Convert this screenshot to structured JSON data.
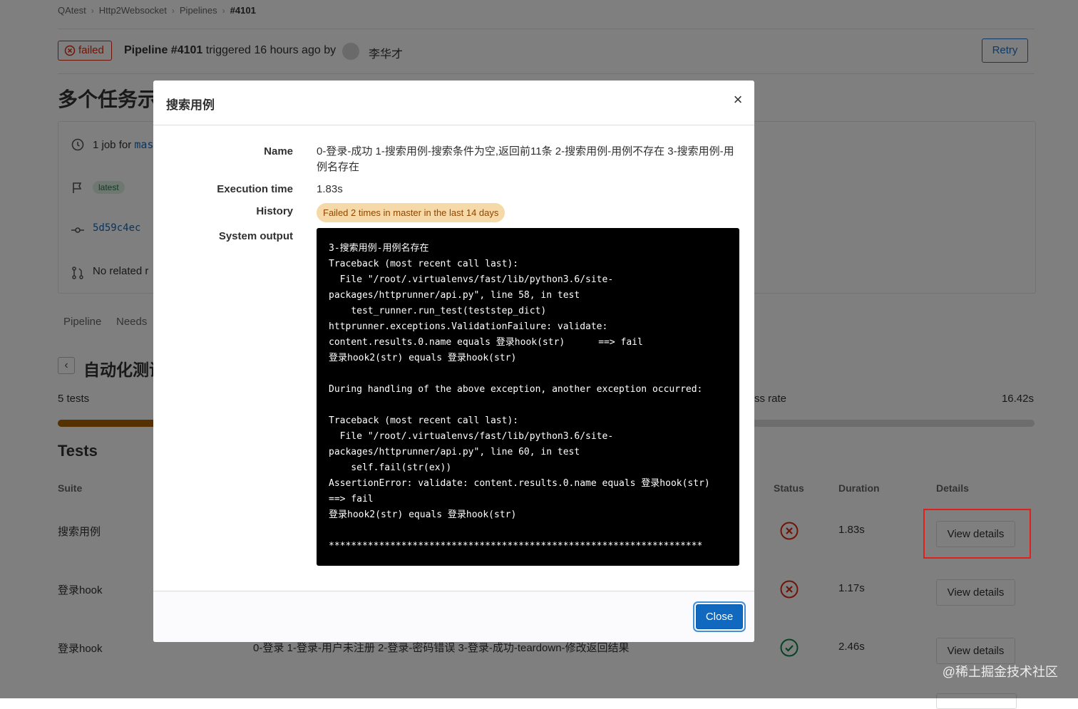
{
  "breadcrumb": {
    "items": [
      "QAtest",
      "Http2Websocket",
      "Pipelines"
    ],
    "current": "#4101"
  },
  "pipeline_header": {
    "status_label": "failed",
    "pipeline_id": "Pipeline #4101",
    "triggered_text": "triggered 16 hours ago by",
    "user_name": "李华才",
    "retry_label": "Retry"
  },
  "page_title": "多个任务示",
  "info": {
    "jobs_text": "1 job for",
    "branch_fragment": "mas",
    "latest_badge": "latest",
    "commit_sha": "5d59c4ec",
    "no_related": "No related r"
  },
  "tabs": [
    "Pipeline",
    "Needs"
  ],
  "report": {
    "title_fragment": "自动化测试",
    "tests_count": "5 tests",
    "rate_fragment": "ss rate",
    "total_duration": "16.42s",
    "progress_fraction": 0.35
  },
  "tests_section": {
    "heading": "Tests",
    "columns": {
      "suite": "Suite",
      "status": "Status",
      "duration": "Duration",
      "details": "Details"
    },
    "rows": [
      {
        "suite": "搜索用例",
        "name": "",
        "status": "failed",
        "duration": "1.83s",
        "action": "View details"
      },
      {
        "suite": "登录hook",
        "name": "",
        "status": "failed",
        "duration": "1.17s",
        "action": "View details"
      },
      {
        "suite": "登录hook",
        "name": "0-登录 1-登录-用户未注册 2-登录-密码错误 3-登录-成功-teardown-修改返回结果",
        "status": "success",
        "duration": "2.46s",
        "action": "View details"
      }
    ]
  },
  "modal": {
    "title": "搜索用例",
    "labels": {
      "name": "Name",
      "execution_time": "Execution time",
      "history": "History",
      "system_output": "System output"
    },
    "name_value": "0-登录-成功 1-搜索用例-搜索条件为空,返回前11条 2-搜索用例-用例不存在 3-搜索用例-用例名存在",
    "execution_time_value": "1.83s",
    "history_value": "Failed 2 times in master in the last 14 days",
    "system_output": "3-搜索用例-用例名存在\nTraceback (most recent call last):\n  File \"/root/.virtualenvs/fast/lib/python3.6/site-\npackages/httprunner/api.py\", line 58, in test\n    test_runner.run_test(teststep_dict)\nhttprunner.exceptions.ValidationFailure: validate:\ncontent.results.0.name equals 登录hook(str)      ==> fail\n登录hook2(str) equals 登录hook(str)\n\nDuring handling of the above exception, another exception occurred:\n\nTraceback (most recent call last):\n  File \"/root/.virtualenvs/fast/lib/python3.6/site-\npackages/httprunner/api.py\", line 60, in test\n    self.fail(str(ex))\nAssertionError: validate: content.results.0.name equals 登录hook(str)\n==> fail\n登录hook2(str) equals 登录hook(str)\n\n*******************************************************************",
    "close_label": "Close",
    "close_icon": "×"
  },
  "watermark": "@稀土掘金技术社区",
  "colors": {
    "failed": "#dd2b0e",
    "success": "#108548",
    "primary": "#1068bf",
    "warning_bg": "#f5d9a8",
    "highlight_box": "#e0211b"
  }
}
